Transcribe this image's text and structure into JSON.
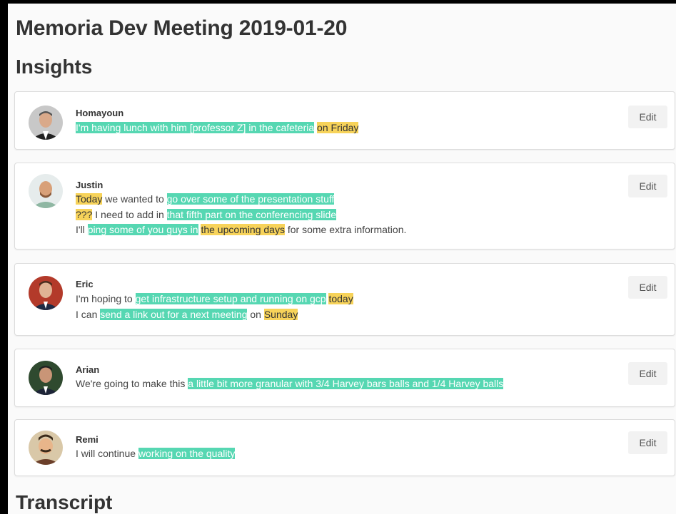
{
  "page": {
    "title": "Memoria Dev Meeting 2019-01-20",
    "insights_heading": "Insights",
    "transcript_heading": "Transcript"
  },
  "colors": {
    "entity_highlight": "#56d7b2",
    "time_highlight": "#f7d35a"
  },
  "insights": [
    {
      "name": "Homayoun",
      "avatar": "avatar-homayoun",
      "edit_label": "Edit",
      "lines": [
        [
          {
            "t": "I'm having lunch with him [professor Z] in the cafeteria",
            "h": "entity"
          },
          {
            "t": " ",
            "h": ""
          },
          {
            "t": "on Friday",
            "h": "time"
          }
        ]
      ]
    },
    {
      "name": "Justin",
      "avatar": "avatar-justin",
      "edit_label": "Edit",
      "lines": [
        [
          {
            "t": "Today",
            "h": "time"
          },
          {
            "t": " we wanted to ",
            "h": ""
          },
          {
            "t": "go over some of the presentation stuff",
            "h": "entity"
          }
        ],
        [
          {
            "t": "???",
            "h": "time"
          },
          {
            "t": " I need to add in ",
            "h": ""
          },
          {
            "t": "that fifth part on the conferencing slide",
            "h": "entity"
          }
        ],
        [
          {
            "t": "I'll ",
            "h": ""
          },
          {
            "t": "ping some of you guys in",
            "h": "entity"
          },
          {
            "t": " ",
            "h": ""
          },
          {
            "t": "the upcoming days",
            "h": "time"
          },
          {
            "t": " for some extra information.",
            "h": ""
          }
        ]
      ]
    },
    {
      "name": "Eric",
      "avatar": "avatar-eric",
      "edit_label": "Edit",
      "lines": [
        [
          {
            "t": "I'm hoping to ",
            "h": ""
          },
          {
            "t": "get infrastructure setup and running on gcp",
            "h": "entity"
          },
          {
            "t": " ",
            "h": ""
          },
          {
            "t": "today",
            "h": "time"
          }
        ],
        [
          {
            "t": "I can ",
            "h": ""
          },
          {
            "t": "send a link out for a next meeting",
            "h": "entity"
          },
          {
            "t": " on ",
            "h": ""
          },
          {
            "t": "Sunday",
            "h": "time"
          }
        ]
      ]
    },
    {
      "name": "Arian",
      "avatar": "avatar-arian",
      "edit_label": "Edit",
      "lines": [
        [
          {
            "t": "We're going to make this ",
            "h": ""
          },
          {
            "t": "a little bit more granular with 3/4 Harvey bars balls and 1/4 Harvey balls",
            "h": "entity"
          }
        ]
      ]
    },
    {
      "name": "Remi",
      "avatar": "avatar-remi",
      "edit_label": "Edit",
      "lines": [
        [
          {
            "t": "I will continue ",
            "h": ""
          },
          {
            "t": "working on the quality",
            "h": "entity"
          }
        ]
      ]
    }
  ]
}
